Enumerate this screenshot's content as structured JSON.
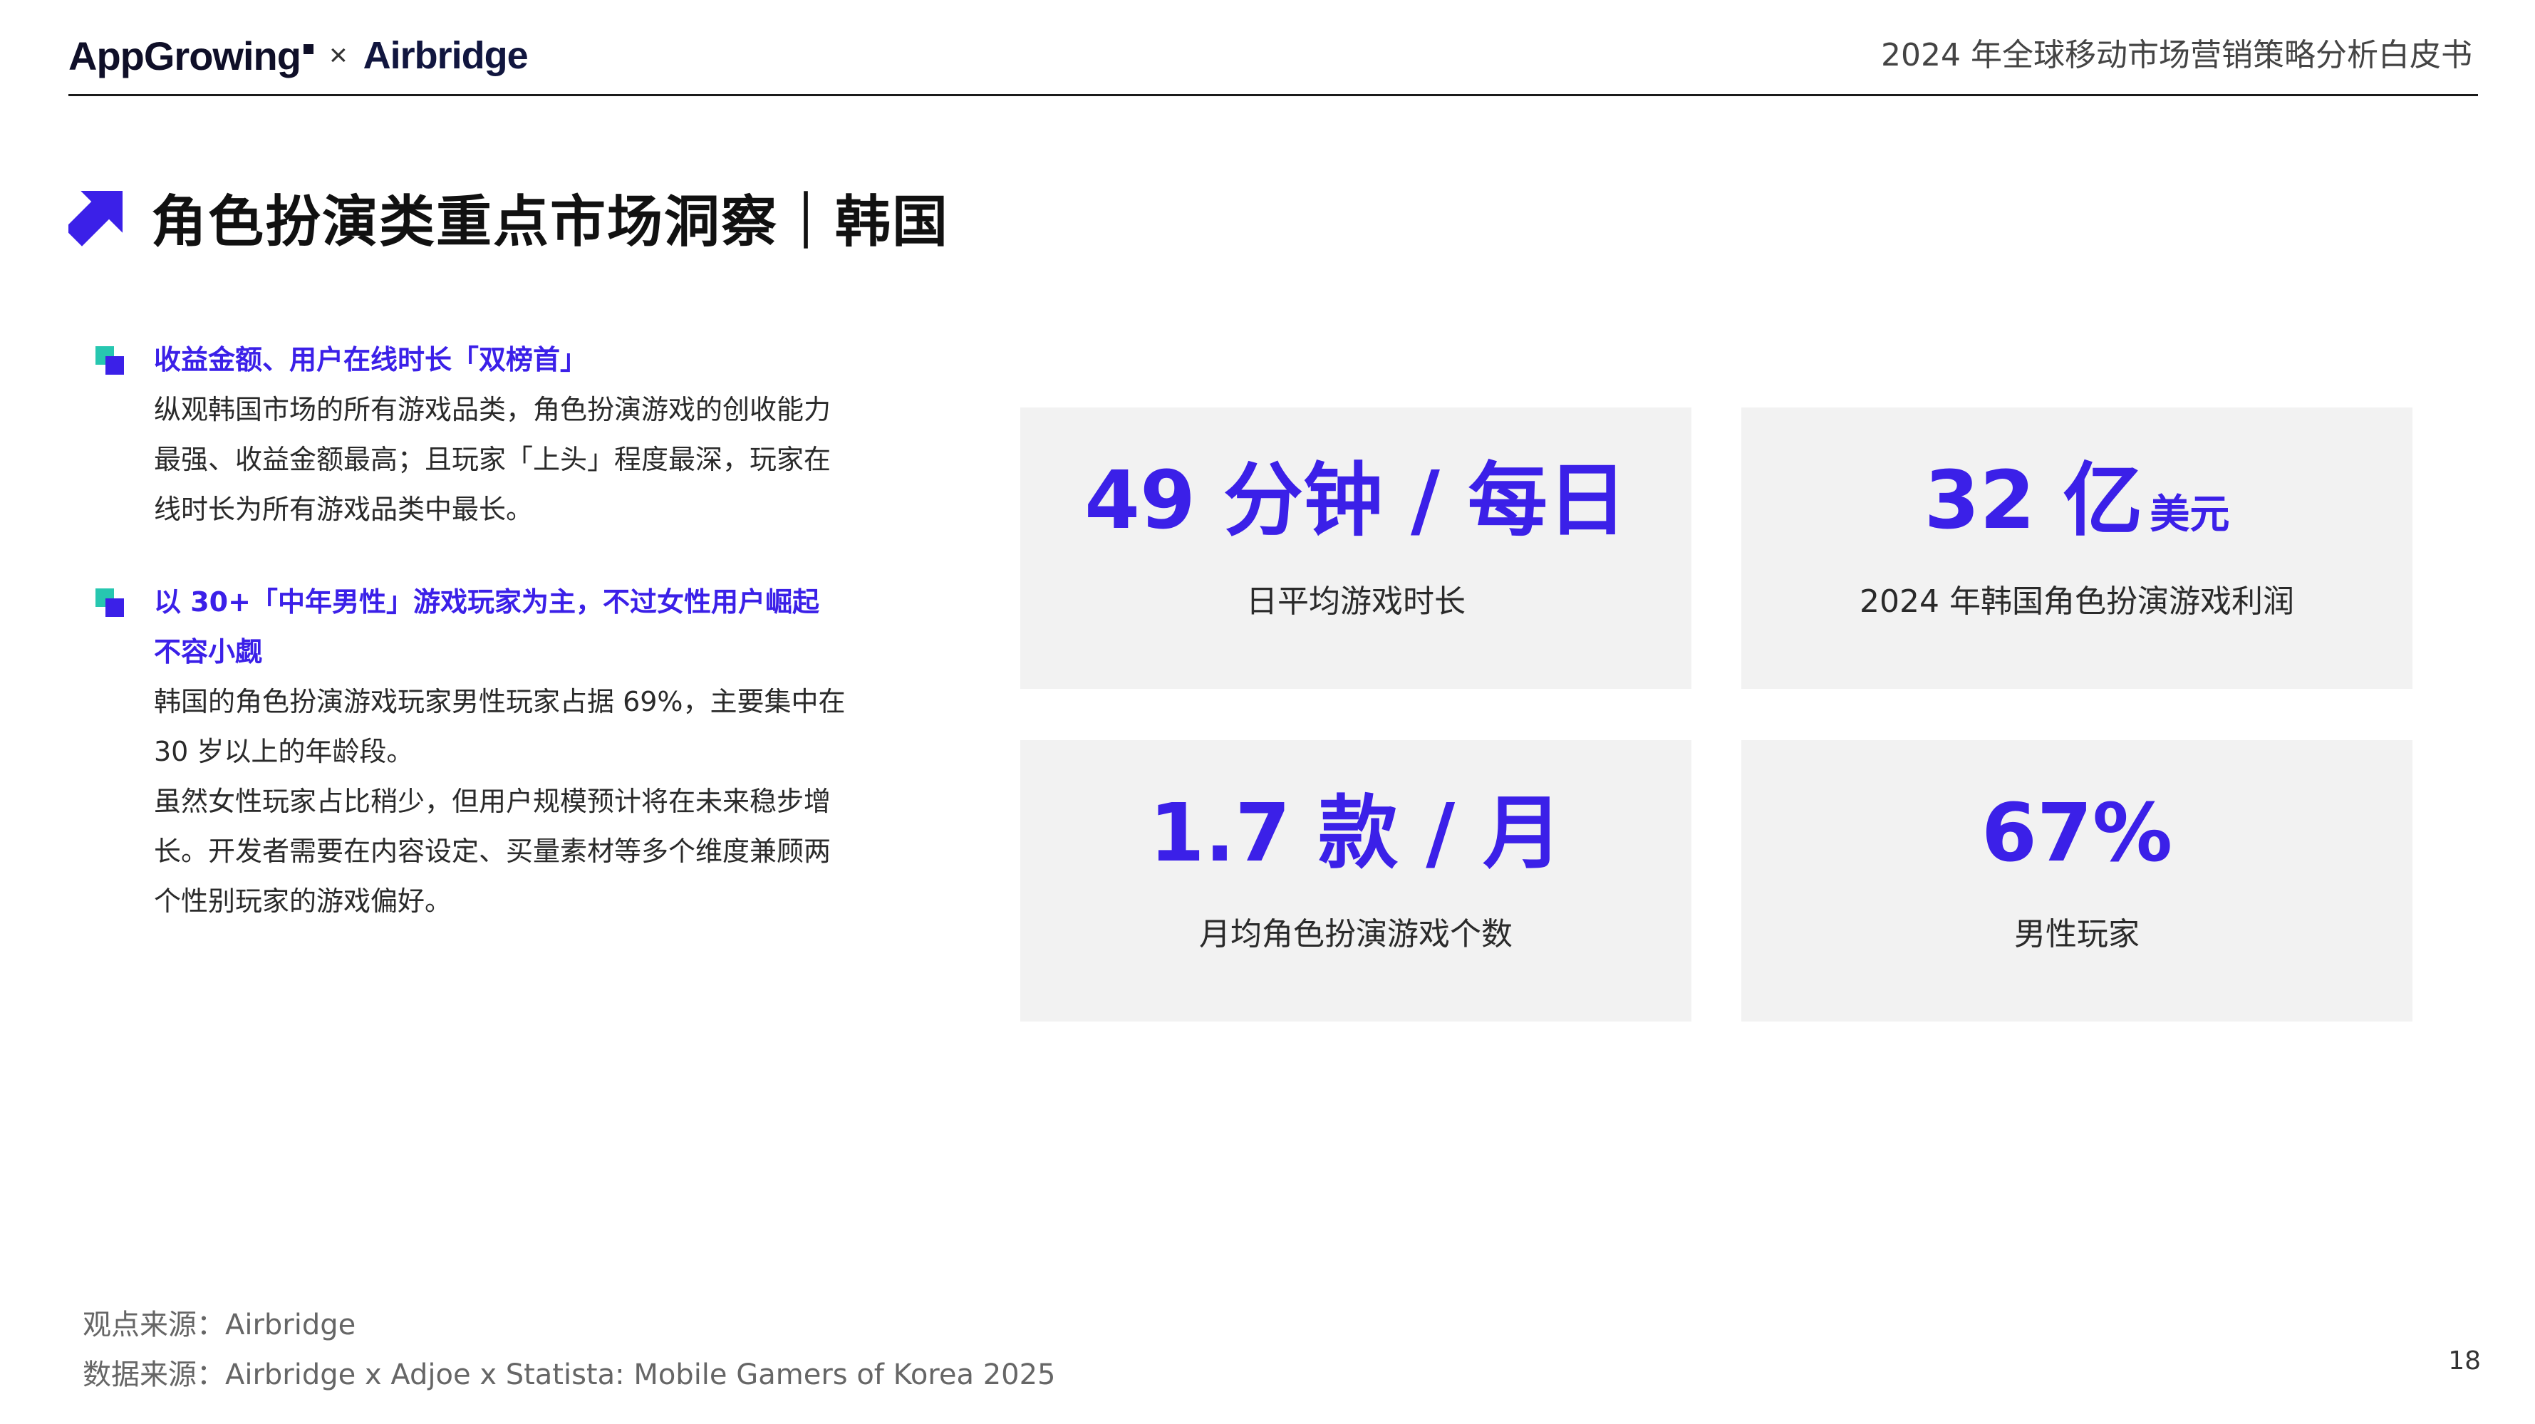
{
  "header": {
    "brand_app": "AppGrowing",
    "brand_times": "×",
    "brand_partner": "Airbridge",
    "report_title": "2024 年全球移动市场营销策略分析白皮书"
  },
  "section": {
    "title": "角色扮演类重点市场洞察｜韩国"
  },
  "points": [
    {
      "head": "收益金额、用户在线时长「双榜首」",
      "body": [
        "纵观韩国市场的所有游戏品类，角色扮演游戏的创收能力",
        "最强、收益金额最高；且玩家「上头」程度最深，玩家在",
        "线时长为所有游戏品类中最长。"
      ]
    },
    {
      "head": [
        "以 30+「中年男性」游戏玩家为主，不过女性用户崛起",
        "不容小觑"
      ],
      "body": [
        "韩国的角色扮演游戏玩家男性玩家占据 69%，主要集中在",
        "30 岁以上的年龄段。",
        "虽然女性玩家占比稍少，但用户规模预计将在未来稳步增",
        "长。开发者需要在内容设定、买量素材等多个维度兼顾两",
        "个性别玩家的游戏偏好。"
      ]
    }
  ],
  "stats": [
    {
      "value": "49 分钟 / 每日",
      "unit": "",
      "label": "日平均游戏时长"
    },
    {
      "value": "32 亿",
      "unit": "美元",
      "label": "2024 年韩国角色扮演游戏利润"
    },
    {
      "value": "1.7 款 / 月",
      "unit": "",
      "label": "月均角色扮演游戏个数"
    },
    {
      "value": "67%",
      "unit": "",
      "label": "男性玩家"
    }
  ],
  "footer": {
    "opinion_source": "观点来源：Airbridge",
    "data_source": "数据来源：Airbridge x Adjoe x Statista: Mobile Gamers of Korea 2025",
    "page_number": "18"
  },
  "colors": {
    "accent": "#3b20e8",
    "bullet_teal": "#27c7b0",
    "card_bg": "#f2f2f2"
  },
  "icons": {
    "section_icon": "arrow-up-right-icon",
    "bullet_icon": "square-bullet-icon"
  }
}
